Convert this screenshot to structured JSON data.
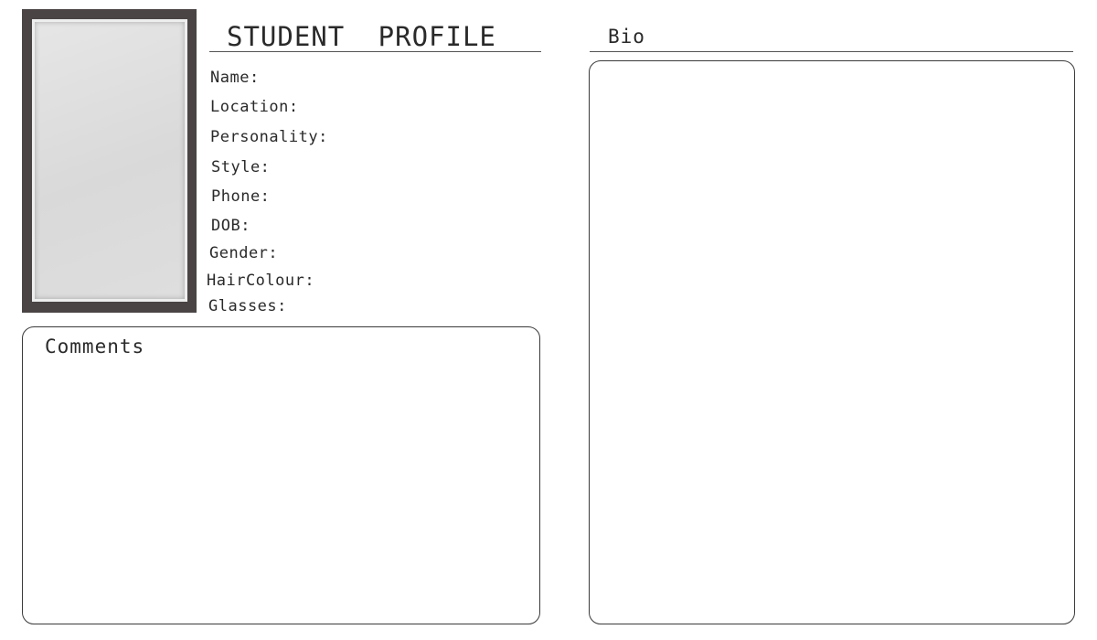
{
  "profile": {
    "title": "STUDENT PROFILE",
    "fields": [
      {
        "label": "Name:"
      },
      {
        "label": "Location:"
      },
      {
        "label": "Personality:"
      },
      {
        "label": "Style:"
      },
      {
        "label": "Phone:"
      },
      {
        "label": "DOB:"
      },
      {
        "label": "Gender:"
      },
      {
        "label": "HairColour:"
      },
      {
        "label": "Glasses:"
      }
    ]
  },
  "comments": {
    "label": "Comments"
  },
  "bio": {
    "label": "Bio"
  },
  "colors": {
    "frame": "#4a4444",
    "photo_placeholder": "#dcdcdc",
    "text": "#2a2a2a",
    "border": "#3a3a3a"
  }
}
